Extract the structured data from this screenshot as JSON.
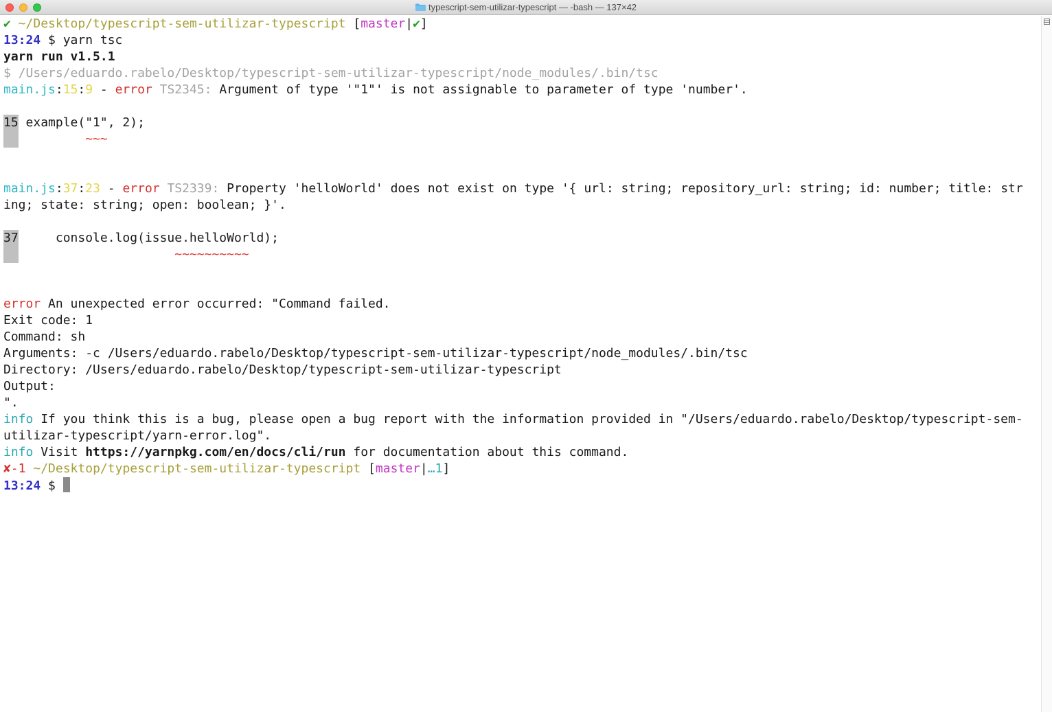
{
  "window": {
    "title": "typescript-sem-utilizar-typescript — -bash — 137×42"
  },
  "prompt1": {
    "status_icon": "✔",
    "path": "~/Desktop/typescript-sem-utilizar-typescript",
    "open_bracket": "[",
    "branch": "master",
    "sep": "|",
    "branch_status": "✔",
    "close_bracket": "]"
  },
  "cmd1": {
    "time": "13:24",
    "dollar": " $ ",
    "command": "yarn tsc"
  },
  "yarn_header": "yarn run v1.5.1",
  "tsc_path": "$ /Users/eduardo.rabelo/Desktop/typescript-sem-utilizar-typescript/node_modules/.bin/tsc",
  "error1": {
    "file": "main.js",
    "colon1": ":",
    "line": "15",
    "colon2": ":",
    "col": "9",
    "dash": " - ",
    "level": "error",
    "code": " TS2345:",
    "message": " Argument of type '\"1\"' is not assignable to parameter of type 'number'.",
    "gutter": "15",
    "source": " example(\"1\", 2);",
    "squiggle": "~~~"
  },
  "error2": {
    "file": "main.js",
    "colon1": ":",
    "line": "37",
    "colon2": ":",
    "col": "23",
    "dash": " - ",
    "level": "error",
    "code": " TS2339:",
    "message": " Property 'helloWorld' does not exist on type '{ url: string; repository_url: string; id: number; title: str",
    "message_cont": "ing; state: string; open: boolean; }'.",
    "gutter": "37",
    "source": "     console.log(issue.helloWorld);",
    "squiggle": "~~~~~~~~~~"
  },
  "failure": {
    "level": "error",
    "message": " An unexpected error occurred: \"Command failed.",
    "exit_code": "Exit code: 1",
    "command": "Command: sh",
    "arguments": "Arguments: -c /Users/eduardo.rabelo/Desktop/typescript-sem-utilizar-typescript/node_modules/.bin/tsc",
    "directory": "Directory: /Users/eduardo.rabelo/Desktop/typescript-sem-utilizar-typescript",
    "output": "Output:",
    "closing": "\"."
  },
  "info1": {
    "level": "info",
    "message": " If you think this is a bug, please open a bug report with the information provided in \"/Users/eduardo.rabelo/Desktop/typescript-sem-",
    "message_cont": "utilizar-typescript/yarn-error.log\"."
  },
  "info2": {
    "level": "info",
    "pre": " Visit ",
    "url": "https://yarnpkg.com/en/docs/cli/run",
    "post": " for documentation about this command."
  },
  "prompt2": {
    "status_icon": "✘",
    "exit_code": "-1",
    "path": " ~/Desktop/typescript-sem-utilizar-typescript",
    "open_bracket": " [",
    "branch": "master",
    "sep": "|",
    "branch_status": "…1",
    "close_bracket": "]"
  },
  "cmd2": {
    "time": "13:24",
    "dollar": " $ "
  },
  "colors": {
    "ok_green": "#22a123",
    "path_olive": "#a8a03a",
    "branch_magenta": "#c135c2",
    "time_blue": "#3431c7",
    "error_red": "#d3302d",
    "file_cyan": "#2fb8c8"
  }
}
